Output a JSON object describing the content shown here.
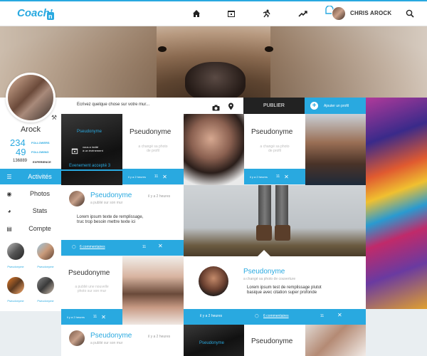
{
  "nav": {
    "logo_text": "Coach'n",
    "user_name": "CHRIS AROCK",
    "icons": [
      "home-icon",
      "calendar-icon",
      "running-icon",
      "trend-icon",
      "search-icon"
    ]
  },
  "profile": {
    "name": "Arock",
    "followers": "234",
    "followers_label": "FOLLOWERS",
    "following": "49",
    "following_label": "FOLLOWING",
    "experience": "136889",
    "experience_label": "EXPERIENCE"
  },
  "sidebar": {
    "items": [
      {
        "label": "Activités",
        "icon": "list-icon"
      },
      {
        "label": "Photos",
        "icon": "camera-icon"
      },
      {
        "label": "Stats",
        "icon": "pie-icon"
      },
      {
        "label": "Compte",
        "icon": "card-icon"
      }
    ],
    "friends": [
      "Pseudonyme",
      "Pseudonyme",
      "Pseudonyme",
      "Pseudonyme"
    ]
  },
  "post": {
    "placeholder": "Ecrivez quelque chose sur votre mur...",
    "publish": "PUBLIER",
    "add_profile": "Ajouter un profil"
  },
  "event_card": {
    "name": "Pseudonyme",
    "text1": "vous a invité",
    "text2": "à un événement",
    "footer": "Evenement accepté 3"
  },
  "card_a": {
    "name": "Pseudonyme",
    "sub1": "a changé sa photo",
    "sub2": "de profil",
    "time": "il y a 2 heures",
    "count": "11"
  },
  "card_b": {
    "name": "Pseudonyme",
    "sub1": "a changé sa photo",
    "sub2": "de profil",
    "time": "il y a 2 heures",
    "count": "11"
  },
  "post_card": {
    "name": "Pseudonyme",
    "time": "il y a 2 heures",
    "sub": "a publié sur son mur",
    "body1": "Lorem ipsum texte de remplissage,",
    "body2": "truc trop besoin mettre texte ici",
    "comments": "6 commentaires",
    "count": "11"
  },
  "card_c": {
    "name": "Pseudonyme",
    "sub1": "a publié une nouvelle",
    "sub2": "photo sur son mur",
    "time": "il y a 2 heures",
    "count": "11"
  },
  "cover_card": {
    "name": "Pseudonyme",
    "sub": "a changé sa photo de couverture",
    "body1": "Lorem ipsum test de remplissage plutot",
    "body2": "basique avec citation super profonde",
    "time": "il y a 2 heures",
    "comments": "6 commentaires",
    "count": "11"
  },
  "post_card2": {
    "name": "Pseudonyme",
    "time": "il y a 2 heures",
    "sub": "a publié sur son mur"
  },
  "event_card2": {
    "name": "Pseudonyme"
  },
  "card_d": {
    "name": "Pseudonyme"
  },
  "colors": {
    "accent": "#29a9e0",
    "dark": "#222222"
  }
}
